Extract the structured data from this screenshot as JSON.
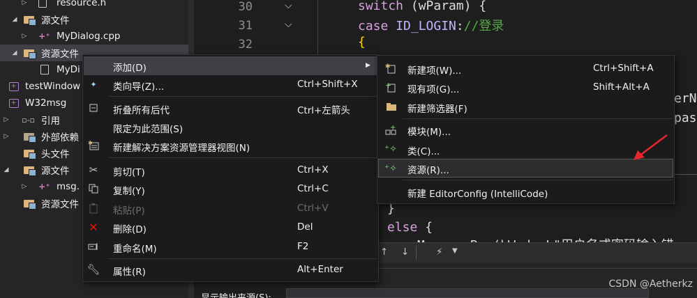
{
  "explorer": {
    "rows": [
      {
        "label": "resource.h",
        "icon": "header-file-icon",
        "expander": "▷"
      },
      {
        "label": "源文件",
        "icon": "folder-icon",
        "expander": "◢"
      },
      {
        "label": "MyDialog.cpp",
        "icon": "cpp-file-icon",
        "expander": "▷"
      },
      {
        "label": "资源文件",
        "icon": "folder-icon",
        "expander": "◢"
      },
      {
        "label": "MyDi",
        "icon": "resource-file-icon",
        "expander": ""
      },
      {
        "label": "testWindow",
        "icon": "project-icon",
        "expander": ""
      },
      {
        "label": "W32msg",
        "icon": "project-icon",
        "expander": "◢"
      },
      {
        "label": "引用",
        "icon": "references-icon",
        "expander": "▷"
      },
      {
        "label": "外部依赖",
        "icon": "external-deps-icon",
        "expander": "▷"
      },
      {
        "label": "头文件",
        "icon": "folder-icon",
        "expander": ""
      },
      {
        "label": "源文件",
        "icon": "folder-icon",
        "expander": "◢"
      },
      {
        "label": "msg.",
        "icon": "cpp-file-icon",
        "expander": "▷"
      },
      {
        "label": "资源文件",
        "icon": "folder-icon",
        "expander": ""
      }
    ]
  },
  "editor": {
    "line_numbers": [
      "30",
      "31",
      "32"
    ],
    "code": {
      "l1_kw": "switch",
      "l1_rest": " (wParam) {",
      "l2_kw": "case",
      "l2_macro": " ID_LOGIN",
      "l2_colon": ":",
      "l2_comment": "//登录",
      "l3": "{",
      "peek1": "erN",
      "peek2": "pas",
      "close": "}",
      "else_kw": "else",
      "else_brace": " {",
      "call": "MessageBox(hWnd, L\"用户名或密码输入错"
    }
  },
  "context_menu": {
    "items": [
      {
        "label": "添加(D)",
        "shortcut": "",
        "icon": ""
      },
      {
        "label": "类向导(Z)...",
        "shortcut": "Ctrl+Shift+X",
        "icon": "class-wizard-icon"
      },
      {
        "label": "折叠所有后代",
        "shortcut": "Ctrl+左箭头",
        "icon": "collapse-icon"
      },
      {
        "label": "限定为此范围(S)",
        "shortcut": "",
        "icon": ""
      },
      {
        "label": "新建解决方案资源管理器视图(N)",
        "shortcut": "",
        "icon": "new-view-icon"
      },
      {
        "label": "剪切(T)",
        "shortcut": "Ctrl+X",
        "icon": "cut-icon"
      },
      {
        "label": "复制(Y)",
        "shortcut": "Ctrl+C",
        "icon": "copy-icon"
      },
      {
        "label": "粘贴(P)",
        "shortcut": "Ctrl+V",
        "icon": "paste-icon"
      },
      {
        "label": "删除(D)",
        "shortcut": "Del",
        "icon": "delete-icon"
      },
      {
        "label": "重命名(M)",
        "shortcut": "F2",
        "icon": "rename-icon"
      },
      {
        "label": "属性(R)",
        "shortcut": "Alt+Enter",
        "icon": "wrench-icon"
      }
    ],
    "submenu_arrow": "▶"
  },
  "submenu": {
    "items": [
      {
        "label": "新建项(W)...",
        "shortcut": "Ctrl+Shift+A",
        "icon": "new-item-icon"
      },
      {
        "label": "现有项(G)...",
        "shortcut": "Shift+Alt+A",
        "icon": "existing-item-icon"
      },
      {
        "label": "新建筛选器(F)",
        "shortcut": "",
        "icon": "new-filter-icon"
      },
      {
        "label": "模块(M)...",
        "shortcut": "",
        "icon": "module-icon"
      },
      {
        "label": "类(C)...",
        "shortcut": "",
        "icon": "class-icon"
      },
      {
        "label": "资源(R)...",
        "shortcut": "",
        "icon": "resource-icon"
      },
      {
        "label": "新建 EditorConfig (IntelliCode)",
        "shortcut": "",
        "icon": ""
      }
    ]
  },
  "output": {
    "label": "显示输出来源(S):",
    "toolbar": [
      "↑",
      "↓",
      "⚡"
    ]
  },
  "watermark": "CSDN @Aetherkz",
  "colors": {
    "accent_arrow": "#e8262b",
    "menu_bg": "#1b1b1c",
    "highlight": "#3f3f46"
  }
}
